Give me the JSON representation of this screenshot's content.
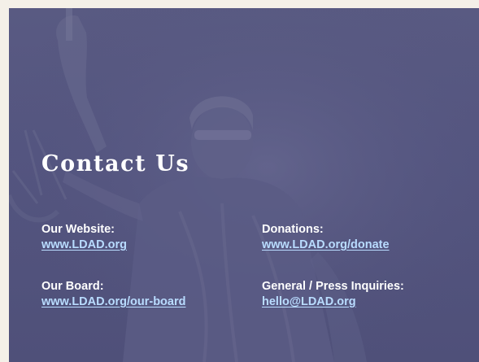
{
  "card": {
    "title": "Contact Us",
    "background_color": "#565781",
    "link_color": "#b9dcff"
  },
  "contacts": [
    {
      "label": "Our Website:",
      "link": "www.LDAD.org"
    },
    {
      "label": "Donations:",
      "link": "www.LDAD.org/donate"
    },
    {
      "label": "Our Board:",
      "link": "www.LDAD.org/our-board"
    },
    {
      "label": "General / Press Inquiries:",
      "link": "hello@LDAD.org"
    }
  ],
  "background_image": "lady-justice-statue"
}
